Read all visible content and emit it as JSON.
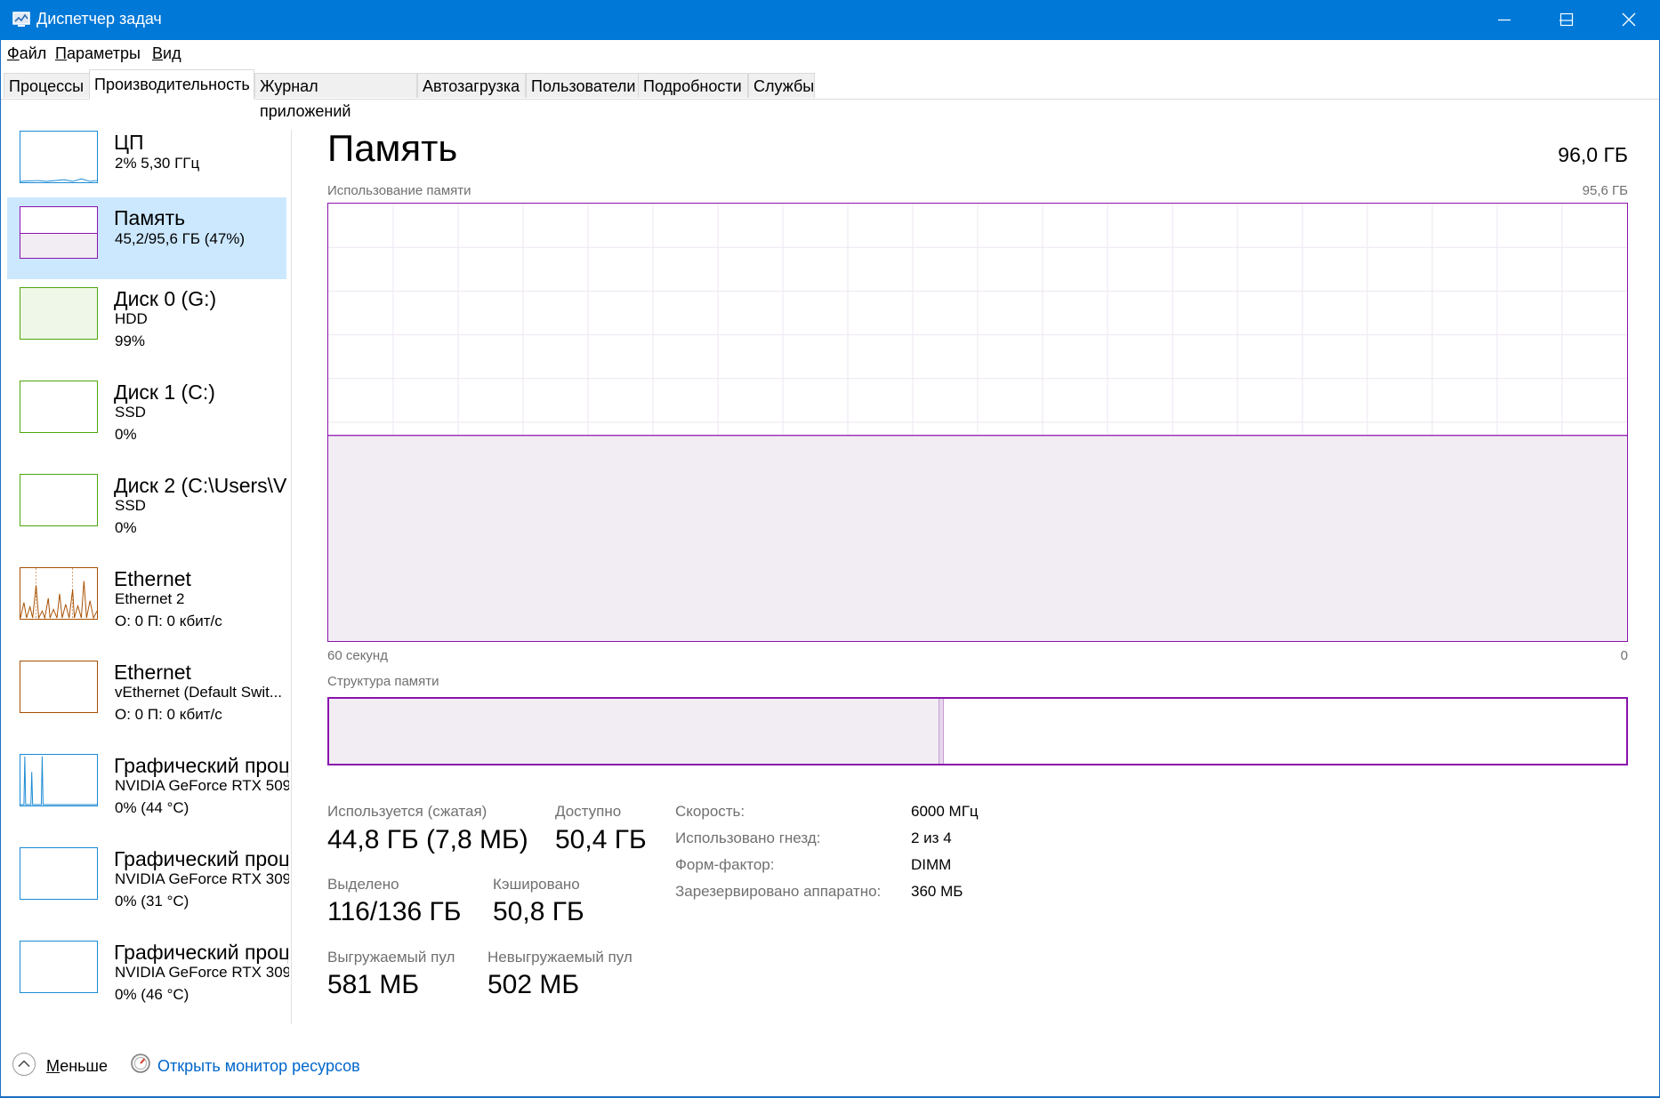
{
  "window": {
    "title": "Диспетчер задач",
    "icon": "task-manager-icon",
    "controls": [
      "minimize-icon",
      "maximize-icon",
      "close-icon"
    ],
    "accent": "#0078d7"
  },
  "menu": {
    "items": [
      {
        "label": "Файл",
        "accel": "Ф",
        "rest": "айл"
      },
      {
        "label": "Параметры",
        "accel": "П",
        "rest": "араметры"
      },
      {
        "label": "Вид",
        "accel": "В",
        "rest": "ид"
      }
    ]
  },
  "tabs": [
    {
      "label": "Процессы",
      "active": false
    },
    {
      "label": "Производительность",
      "active": true
    },
    {
      "label": "Журнал приложений",
      "active": false
    },
    {
      "label": "Автозагрузка",
      "active": false
    },
    {
      "label": "Пользователи",
      "active": false
    },
    {
      "label": "Подробности",
      "active": false
    },
    {
      "label": "Службы",
      "active": false
    }
  ],
  "sidebar": {
    "items": [
      {
        "title": "ЦП",
        "line1": "2%  5,30 ГГц",
        "line2": "",
        "color": "#1a8ad4",
        "selected": false
      },
      {
        "title": "Память",
        "line1": "45,2/95,6 ГБ (47%)",
        "line2": "",
        "color": "#8b12ae",
        "selected": true,
        "usage_percent": 47
      },
      {
        "title": "Диск 0 (G:)",
        "line1": "HDD",
        "line2": "99%",
        "color": "#4da60c",
        "selected": false,
        "usage_percent": 99
      },
      {
        "title": "Диск 1 (C:)",
        "line1": "SSD",
        "line2": "0%",
        "color": "#4da60c",
        "selected": false
      },
      {
        "title": "Диск 2 (C:\\Users\\V",
        "line1": "SSD",
        "line2": "0%",
        "color": "#4da60c",
        "selected": false
      },
      {
        "title": "Ethernet",
        "line1": "Ethernet 2",
        "line2": "О: 0  П: 0 кбит/с",
        "color": "#a74f01",
        "selected": false
      },
      {
        "title": "Ethernet",
        "line1": "vEthernet (Default Swit...",
        "line2": "О: 0  П: 0 кбит/с",
        "color": "#a74f01",
        "selected": false
      },
      {
        "title": "Графический проц",
        "line1": "NVIDIA GeForce RTX 509",
        "line2": "0% (44 °C)",
        "color": "#1a8ad4",
        "selected": false
      },
      {
        "title": "Графический проц",
        "line1": "NVIDIA GeForce RTX 309",
        "line2": "0% (31 °C)",
        "color": "#1a8ad4",
        "selected": false
      },
      {
        "title": "Графический проц",
        "line1": "NVIDIA GeForce RTX 309",
        "line2": "0% (46 °C)",
        "color": "#1a8ad4",
        "selected": false
      }
    ]
  },
  "main": {
    "title": "Память",
    "total": "96,0 ГБ",
    "usage_label": "Использование памяти",
    "usage_max": "95,6 ГБ",
    "axis_left": "60 секунд",
    "axis_right": "0",
    "usage_percent": 47,
    "structure_label": "Структура памяти",
    "structure_used_fraction": 0.47,
    "accent": "#8b12ae",
    "stats": {
      "in_use_label": "Используется (сжатая)",
      "in_use_value": "44,8 ГБ (7,8 МБ)",
      "available_label": "Доступно",
      "available_value": "50,4 ГБ",
      "committed_label": "Выделено",
      "committed_value": "116/136 ГБ",
      "cached_label": "Кэшировано",
      "cached_value": "50,8 ГБ",
      "paged_label": "Выгружаемый пул",
      "paged_value": "581 МБ",
      "nonpaged_label": "Невыгружаемый пул",
      "nonpaged_value": "502 МБ"
    },
    "props": [
      {
        "label": "Скорость:",
        "value": "6000 МГц"
      },
      {
        "label": "Использовано гнезд:",
        "value": "2 из 4"
      },
      {
        "label": "Форм-фактор:",
        "value": "DIMM"
      },
      {
        "label": "Зарезервировано аппаратно:",
        "value": "360 МБ"
      }
    ]
  },
  "footer": {
    "less_accel": "М",
    "less_rest": "еньше",
    "monitor_link": "Открыть монитор ресурсов"
  }
}
